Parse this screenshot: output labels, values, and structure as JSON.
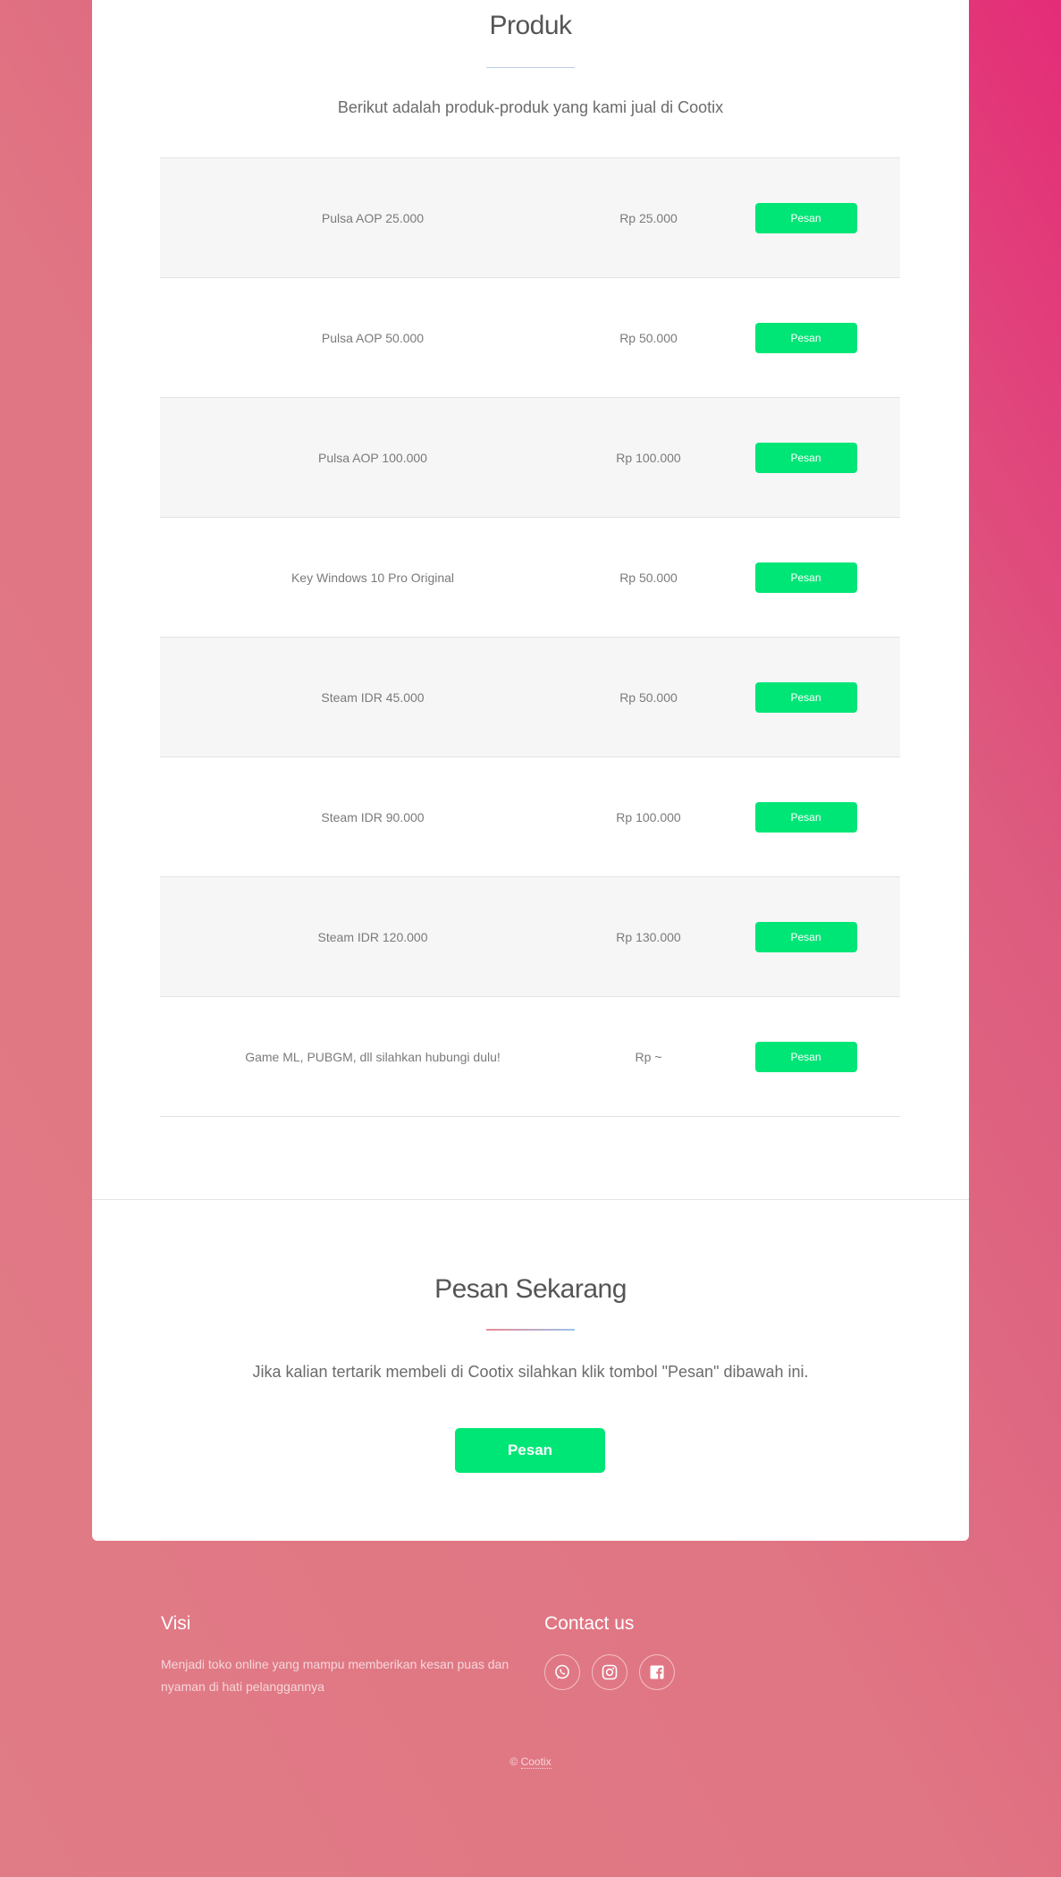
{
  "products_section": {
    "title": "Produk",
    "subtitle": "Berikut adalah produk-produk yang kami jual di Cootix",
    "items": [
      {
        "name": "Pulsa AOP 25.000",
        "price": "Rp 25.000",
        "button": "Pesan"
      },
      {
        "name": "Pulsa AOP 50.000",
        "price": "Rp 50.000",
        "button": "Pesan"
      },
      {
        "name": "Pulsa AOP 100.000",
        "price": "Rp 100.000",
        "button": "Pesan"
      },
      {
        "name": "Key Windows 10 Pro Original",
        "price": "Rp 50.000",
        "button": "Pesan"
      },
      {
        "name": "Steam IDR 45.000",
        "price": "Rp 50.000",
        "button": "Pesan"
      },
      {
        "name": "Steam IDR 90.000",
        "price": "Rp 100.000",
        "button": "Pesan"
      },
      {
        "name": "Steam IDR 120.000",
        "price": "Rp 130.000",
        "button": "Pesan"
      },
      {
        "name": "Game ML, PUBGM, dll silahkan hubungi dulu!",
        "price": "Rp ~",
        "button": "Pesan"
      }
    ]
  },
  "order_section": {
    "title": "Pesan Sekarang",
    "text": "Jika kalian tertarik membeli di Cootix silahkan klik tombol \"Pesan\" dibawah ini.",
    "button": "Pesan"
  },
  "footer": {
    "vision_title": "Visi",
    "vision_text": "Menjadi toko online yang mampu memberikan kesan puas dan nyaman di hati pelanggannya",
    "contact_title": "Contact us",
    "social": [
      {
        "icon": "whatsapp-icon"
      },
      {
        "icon": "instagram-icon"
      },
      {
        "icon": "facebook-icon"
      }
    ],
    "copyright_symbol": "©",
    "copyright_link": "Cootix"
  },
  "colors": {
    "accent_green": "#00e676",
    "background_pink": "#e07583",
    "background_magenta": "#e42c77"
  }
}
